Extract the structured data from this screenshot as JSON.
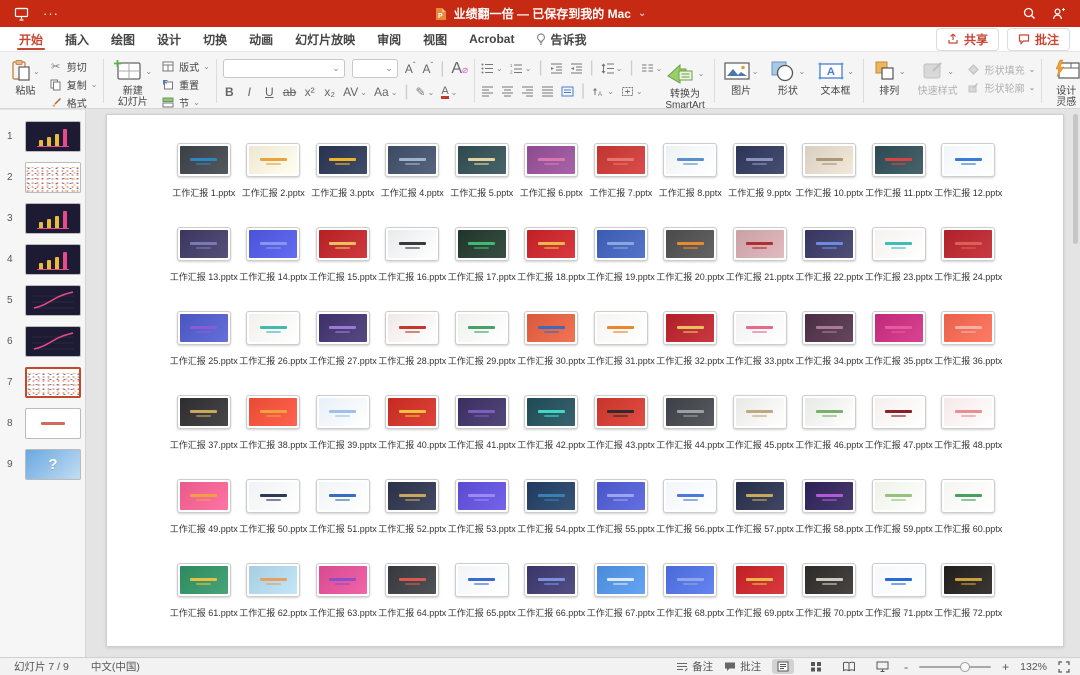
{
  "colors": {
    "titlebar_red": "#c62a12",
    "accent_red": "#c74634",
    "selected_border": "#bf4b2b"
  },
  "titlebar": {
    "overflow": "···",
    "title": "业绩翻一倍 — 已保存到我的 Mac",
    "chevron": "⌄"
  },
  "menubar": {
    "tabs": [
      {
        "label": "开始",
        "active": true
      },
      {
        "label": "插入"
      },
      {
        "label": "绘图"
      },
      {
        "label": "设计"
      },
      {
        "label": "切换"
      },
      {
        "label": "动画"
      },
      {
        "label": "幻灯片放映"
      },
      {
        "label": "审阅"
      },
      {
        "label": "视图"
      },
      {
        "label": "Acrobat"
      },
      {
        "label": "告诉我",
        "icon": "lightbulb"
      }
    ],
    "share_label": "共享",
    "comments_label": "批注"
  },
  "ribbon": {
    "paste": "粘贴",
    "cut": "剪切",
    "copy": "复制",
    "format_painter": "格式",
    "new_slide_line1": "新建",
    "new_slide_line2": "幻灯片",
    "layout": "版式",
    "reset": "重置",
    "section": "节",
    "bold": "B",
    "italic": "I",
    "underline": "U",
    "strike": "ab",
    "superscript": "x²",
    "subscript": "x₂",
    "char_spacing": "AV",
    "change_case": "Aa",
    "grow_font": "A",
    "shrink_font": "A",
    "clear_format": "A",
    "font_color": "A",
    "convert_line1": "转换为",
    "convert_line2": "SmartArt",
    "picture": "图片",
    "shapes": "形状",
    "textbox": "文本框",
    "arrange": "排列",
    "quick_styles": "快速样式",
    "shape_fill": "形状填充",
    "shape_outline": "形状轮廓",
    "design_line1": "设计",
    "design_line2": "灵感"
  },
  "sidebar": {
    "slides": [
      {
        "num": 1,
        "kind": "bar-chart-dark"
      },
      {
        "num": 2,
        "kind": "thumbnail-grid"
      },
      {
        "num": 3,
        "kind": "bar-chart-dark"
      },
      {
        "num": 4,
        "kind": "bar-chart-dark"
      },
      {
        "num": 5,
        "kind": "line-chart-dark"
      },
      {
        "num": 6,
        "kind": "line-chart-dark"
      },
      {
        "num": 7,
        "kind": "thumbnail-grid",
        "selected": true
      },
      {
        "num": 8,
        "kind": "title-text-light"
      },
      {
        "num": 9,
        "kind": "question-mark-blue"
      }
    ]
  },
  "slide": {
    "files": [
      {
        "label": "工作汇报 1.pptx",
        "bg": "#3a3f45",
        "accent": "#2e86c1"
      },
      {
        "label": "工作汇报 2.pptx",
        "bg": "#efe6d4",
        "accent": "#e8a33d"
      },
      {
        "label": "工作汇报 3.pptx",
        "bg": "#27324e",
        "accent": "#f0b429"
      },
      {
        "label": "工作汇报 4.pptx",
        "bg": "#3d4a63",
        "accent": "#9db3d0"
      },
      {
        "label": "工作汇报 5.pptx",
        "bg": "#2e4a4f",
        "accent": "#e3d3a0"
      },
      {
        "label": "工作汇报 6.pptx",
        "bg": "#8e4a8e",
        "accent": "#d977b5"
      },
      {
        "label": "工作汇报 7.pptx",
        "bg": "#bf3330",
        "accent": "#e8766a"
      },
      {
        "label": "工作汇报 8.pptx",
        "bg": "#eef1f4",
        "accent": "#5b8fc9"
      },
      {
        "label": "工作汇报 9.pptx",
        "bg": "#2c3558",
        "accent": "#8a94c0"
      },
      {
        "label": "工作汇报 10.pptx",
        "bg": "#d8cfc0",
        "accent": "#a89878"
      },
      {
        "label": "工作汇报 11.pptx",
        "bg": "#2d4a52",
        "accent": "#d64541"
      },
      {
        "label": "工作汇报 12.pptx",
        "bg": "#f2f5f8",
        "accent": "#3a7bd5"
      },
      {
        "label": "工作汇报 13.pptx",
        "bg": "#3a3660",
        "accent": "#7a78b0"
      },
      {
        "label": "工作汇报 14.pptx",
        "bg": "#4a52d8",
        "accent": "#8a95f0"
      },
      {
        "label": "工作汇报 15.pptx",
        "bg": "#b52025",
        "accent": "#e8c060"
      },
      {
        "label": "工作汇报 16.pptx",
        "bg": "#e8eaec",
        "accent": "#3a3a3a"
      },
      {
        "label": "工作汇报 17.pptx",
        "bg": "#20352a",
        "accent": "#3dba6f"
      },
      {
        "label": "工作汇报 18.pptx",
        "bg": "#c01f25",
        "accent": "#e8b84a"
      },
      {
        "label": "工作汇报 19.pptx",
        "bg": "#3a5bb0",
        "accent": "#8aa5e0"
      },
      {
        "label": "工作汇报 20.pptx",
        "bg": "#4a4a4a",
        "accent": "#e88a2d"
      },
      {
        "label": "工作汇报 21.pptx",
        "bg": "#c9a0a5",
        "accent": "#b03030"
      },
      {
        "label": "工作汇报 22.pptx",
        "bg": "#35355f",
        "accent": "#6b8be0"
      },
      {
        "label": "工作汇报 23.pptx",
        "bg": "#f5f2ee",
        "accent": "#3dbdb5"
      },
      {
        "label": "工作汇报 24.pptx",
        "bg": "#b02028",
        "accent": "#d86055"
      },
      {
        "label": "工作汇报 25.pptx",
        "bg": "#4a55c0",
        "accent": "#8a5bd8"
      },
      {
        "label": "工作汇报 26.pptx",
        "bg": "#f2f0ec",
        "accent": "#45b8b0"
      },
      {
        "label": "工作汇报 27.pptx",
        "bg": "#3d3068",
        "accent": "#9a7ad8"
      },
      {
        "label": "工作汇报 28.pptx",
        "bg": "#f0e8e8",
        "accent": "#c0392b"
      },
      {
        "label": "工作汇报 29.pptx",
        "bg": "#eef2ee",
        "accent": "#4aa06a"
      },
      {
        "label": "工作汇报 30.pptx",
        "bg": "#d85a3a",
        "accent": "#3a6bc0"
      },
      {
        "label": "工作汇报 31.pptx",
        "bg": "#f7f5f2",
        "accent": "#e8872d"
      },
      {
        "label": "工作汇报 32.pptx",
        "bg": "#b01f28",
        "accent": "#e8c060"
      },
      {
        "label": "工作汇报 33.pptx",
        "bg": "#f2f2f2",
        "accent": "#e86a8a"
      },
      {
        "label": "工作汇报 34.pptx",
        "bg": "#4a2d42",
        "accent": "#a87a9a"
      },
      {
        "label": "工作汇报 35.pptx",
        "bg": "#c02878",
        "accent": "#e85aa0"
      },
      {
        "label": "工作汇报 36.pptx",
        "bg": "#e8604a",
        "accent": "#f5b0a8"
      },
      {
        "label": "工作汇报 37.pptx",
        "bg": "#2d2d30",
        "accent": "#c8a85a"
      },
      {
        "label": "工作汇报 38.pptx",
        "bg": "#e84a35",
        "accent": "#f0a03d"
      },
      {
        "label": "工作汇报 39.pptx",
        "bg": "#e8f0f8",
        "accent": "#a0c0e8"
      },
      {
        "label": "工作汇报 40.pptx",
        "bg": "#c52a20",
        "accent": "#f0c040"
      },
      {
        "label": "工作汇报 41.pptx",
        "bg": "#3a2d5f",
        "accent": "#7a5fc0"
      },
      {
        "label": "工作汇报 42.pptx",
        "bg": "#1f4a55",
        "accent": "#3dd8c8"
      },
      {
        "label": "工作汇报 43.pptx",
        "bg": "#c8332a",
        "accent": "#2d2d2d"
      },
      {
        "label": "工作汇报 44.pptx",
        "bg": "#3d4045",
        "accent": "#9aa0a8"
      },
      {
        "label": "工作汇报 45.pptx",
        "bg": "#e8e8e6",
        "accent": "#c0a880"
      },
      {
        "label": "工作汇报 46.pptx",
        "bg": "#e8eae5",
        "accent": "#7ab06a"
      },
      {
        "label": "工作汇报 47.pptx",
        "bg": "#f5f0ee",
        "accent": "#8a2028"
      },
      {
        "label": "工作汇报 48.pptx",
        "bg": "#f5e8e8",
        "accent": "#e89090"
      },
      {
        "label": "工作汇报 49.pptx",
        "bg": "#e85a8a",
        "accent": "#f0a040"
      },
      {
        "label": "工作汇报 50.pptx",
        "bg": "#f0f2f5",
        "accent": "#2d3a55"
      },
      {
        "label": "工作汇报 51.pptx",
        "bg": "#f2f4f6",
        "accent": "#3a6bc0"
      },
      {
        "label": "工作汇报 52.pptx",
        "bg": "#2a3048",
        "accent": "#c8a860"
      },
      {
        "label": "工作汇报 53.pptx",
        "bg": "#5a4ad0",
        "accent": "#9a8af5"
      },
      {
        "label": "工作汇报 54.pptx",
        "bg": "#1f3a5f",
        "accent": "#3a80b0"
      },
      {
        "label": "工作汇报 55.pptx",
        "bg": "#4a55c8",
        "accent": "#9aa5f0"
      },
      {
        "label": "工作汇报 56.pptx",
        "bg": "#f2f5fa",
        "accent": "#4a7bd5"
      },
      {
        "label": "工作汇报 57.pptx",
        "bg": "#252d48",
        "accent": "#c8a85a"
      },
      {
        "label": "工作汇报 58.pptx",
        "bg": "#2d2055",
        "accent": "#b05ad8"
      },
      {
        "label": "工作汇报 59.pptx",
        "bg": "#eef2e8",
        "accent": "#9ac080"
      },
      {
        "label": "工作汇报 60.pptx",
        "bg": "#f5f5f2",
        "accent": "#4aa05a"
      },
      {
        "label": "工作汇报 61.pptx",
        "bg": "#2d8a5f",
        "accent": "#e8c040"
      },
      {
        "label": "工作汇报 62.pptx",
        "bg": "#a8cce0",
        "accent": "#e8a060"
      },
      {
        "label": "工作汇报 63.pptx",
        "bg": "#d84a90",
        "accent": "#8a50c8"
      },
      {
        "label": "工作汇报 64.pptx",
        "bg": "#35383d",
        "accent": "#d85a50"
      },
      {
        "label": "工作汇报 65.pptx",
        "bg": "#f2f4f8",
        "accent": "#3a6bd5"
      },
      {
        "label": "工作汇报 66.pptx",
        "bg": "#3a3568",
        "accent": "#7a90e0"
      },
      {
        "label": "工作汇报 67.pptx",
        "bg": "#4a8ad8",
        "accent": "#dce8f5"
      },
      {
        "label": "工作汇报 68.pptx",
        "bg": "#4a6ad8",
        "accent": "#90a5ea"
      },
      {
        "label": "工作汇报 69.pptx",
        "bg": "#c02025",
        "accent": "#e8b84a"
      },
      {
        "label": "工作汇报 70.pptx",
        "bg": "#2d2a28",
        "accent": "#cfc9c2"
      },
      {
        "label": "工作汇报 71.pptx",
        "bg": "#f5f7fa",
        "accent": "#2a6ad5"
      },
      {
        "label": "工作汇报 72.pptx",
        "bg": "#201d1a",
        "accent": "#c8a040"
      }
    ]
  },
  "statusbar": {
    "slide_counter": "幻灯片 7 / 9",
    "language": "中文(中国)",
    "notes": "备注",
    "comments": "批注",
    "zoom_minus": "-",
    "zoom_plus": "+",
    "zoom_level": "132%"
  }
}
